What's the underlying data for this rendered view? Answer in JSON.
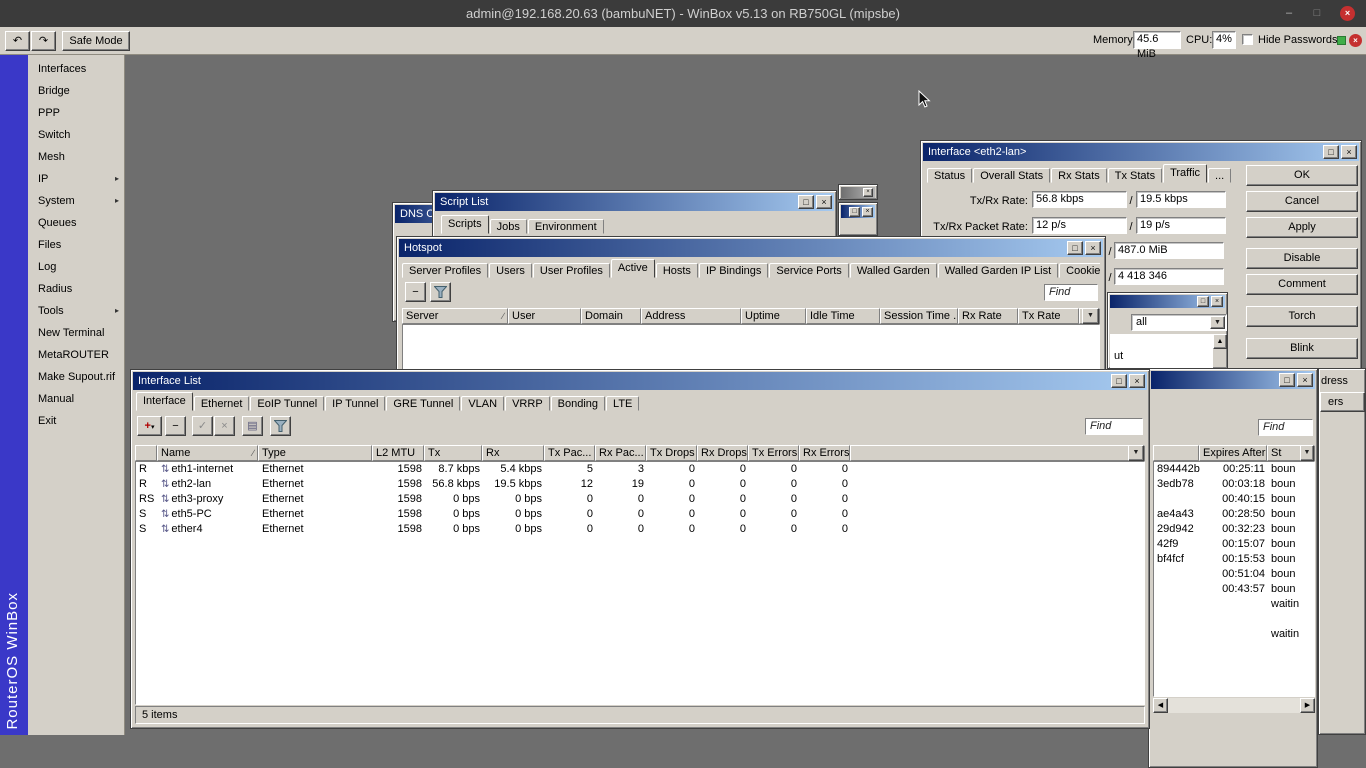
{
  "colors": {
    "titlebar-start": "#0a246a",
    "titlebar-end": "#a6caf0",
    "face": "#d4d0c8",
    "desktop": "#6e6e6e",
    "appbar": "#3b3b3b",
    "brand-blue": "#3a38c8",
    "close-red": "#c53030",
    "ok-green": "#3fae49"
  },
  "icons": {
    "undo": "↶",
    "redo": "↷",
    "minimize": "–",
    "maximize": "□",
    "close": "×",
    "add": "+",
    "remove": "−",
    "enable": "✓",
    "disable": "×",
    "comment": "▤",
    "dropdown": "▼",
    "dropdown_small": "▾",
    "sort": "∕",
    "submenu": "▸",
    "port": "⇅",
    "scroll_up": "▲",
    "scroll_left": "◀",
    "scroll_right": "▶"
  },
  "app": {
    "title": "admin@192.168.20.63 (bambuNET) - WinBox v5.13 on RB750GL (mipsbe)",
    "brand": "RouterOS WinBox"
  },
  "toolbar": {
    "safe_mode": "Safe Mode",
    "memory_label": "Memory:",
    "memory_value": "45.6 MiB",
    "cpu_label": "CPU:",
    "cpu_value": "4%",
    "hide_passwords": "Hide Passwords"
  },
  "menu": {
    "items": [
      {
        "label": "Interfaces"
      },
      {
        "label": "Bridge"
      },
      {
        "label": "PPP"
      },
      {
        "label": "Switch"
      },
      {
        "label": "Mesh"
      },
      {
        "label": "IP",
        "submenu": true
      },
      {
        "label": "System",
        "submenu": true
      },
      {
        "label": "Queues"
      },
      {
        "label": "Files"
      },
      {
        "label": "Log"
      },
      {
        "label": "Radius"
      },
      {
        "label": "Tools",
        "submenu": true
      },
      {
        "label": "New Terminal"
      },
      {
        "label": "MetaROUTER"
      },
      {
        "label": "Make Supout.rif"
      },
      {
        "label": "Manual"
      },
      {
        "label": "Exit"
      }
    ]
  },
  "windows": {
    "dns_cache": {
      "title": "DNS Ca"
    },
    "script_list": {
      "title": "Script List",
      "tabs": [
        "Scripts",
        "Jobs",
        "Environment"
      ],
      "active_tab": "Scripts"
    },
    "interface_detail": {
      "title": "Interface <eth2-lan>",
      "tabs": [
        "Status",
        "Overall Stats",
        "Rx Stats",
        "Tx Stats",
        "Traffic",
        "..."
      ],
      "active_tab": "Traffic",
      "rows": [
        {
          "label": "Tx/Rx Rate:",
          "tx": "56.8 kbps",
          "sep": "/",
          "rx": "19.5 kbps"
        },
        {
          "label": "Tx/Rx Packet Rate:",
          "tx": "12 p/s",
          "sep": "/",
          "rx": "19 p/s"
        }
      ],
      "partial_rows": [
        {
          "sep": "/",
          "value": "487.0 MiB"
        },
        {
          "sep": "/",
          "value": "4 418 346"
        }
      ],
      "buttons": [
        "OK",
        "Cancel",
        "Apply",
        "Disable",
        "Comment",
        "Torch",
        "Blink"
      ]
    },
    "hotspot": {
      "title": "Hotspot",
      "tabs": [
        "Server Profiles",
        "Users",
        "User Profiles",
        "Active",
        "Hosts",
        "IP Bindings",
        "Service Ports",
        "Walled Garden",
        "Walled Garden IP List",
        "Cookies",
        "..."
      ],
      "active_tab": "Active",
      "find": "Find",
      "sorted_column": "Server",
      "columns": [
        "Server",
        "User",
        "Domain",
        "Address",
        "Uptime",
        "Idle Time",
        "Session Time ...",
        "Rx Rate",
        "Tx Rate"
      ]
    },
    "log_fragment": {
      "filter_value": "all",
      "partial_text": "ut"
    },
    "interface_list": {
      "title": "Interface List",
      "tabs": [
        "Interface",
        "Ethernet",
        "EoIP Tunnel",
        "IP Tunnel",
        "GRE Tunnel",
        "VLAN",
        "VRRP",
        "Bonding",
        "LTE"
      ],
      "active_tab": "Interface",
      "find": "Find",
      "sorted_column": "Name",
      "columns": [
        "",
        "Name",
        "Type",
        "L2 MTU",
        "Tx",
        "Rx",
        "Tx Pac...",
        "Rx Pac...",
        "Tx Drops",
        "Rx Drops",
        "Tx Errors",
        "Rx Errors"
      ],
      "rows": [
        {
          "flags": "R",
          "name": "eth1-internet",
          "type": "Ethernet",
          "l2mtu": "1598",
          "tx": "8.7 kbps",
          "rx": "5.4 kbps",
          "tx_packets": "5",
          "rx_packets": "3",
          "tx_drops": "0",
          "rx_drops": "0",
          "tx_errors": "0",
          "rx_errors": "0"
        },
        {
          "flags": "R",
          "name": "eth2-lan",
          "type": "Ethernet",
          "l2mtu": "1598",
          "tx": "56.8 kbps",
          "rx": "19.5 kbps",
          "tx_packets": "12",
          "rx_packets": "19",
          "tx_drops": "0",
          "rx_drops": "0",
          "tx_errors": "0",
          "rx_errors": "0"
        },
        {
          "flags": "RS",
          "name": "eth3-proxy",
          "type": "Ethernet",
          "l2mtu": "1598",
          "tx": "0 bps",
          "rx": "0 bps",
          "tx_packets": "0",
          "rx_packets": "0",
          "tx_drops": "0",
          "rx_drops": "0",
          "tx_errors": "0",
          "rx_errors": "0"
        },
        {
          "flags": "S",
          "name": "eth5-PC",
          "type": "Ethernet",
          "l2mtu": "1598",
          "tx": "0 bps",
          "rx": "0 bps",
          "tx_packets": "0",
          "rx_packets": "0",
          "tx_drops": "0",
          "rx_drops": "0",
          "tx_errors": "0",
          "rx_errors": "0"
        },
        {
          "flags": "S",
          "name": "ether4",
          "type": "Ethernet",
          "l2mtu": "1598",
          "tx": "0 bps",
          "rx": "0 bps",
          "tx_packets": "0",
          "rx_packets": "0",
          "tx_drops": "0",
          "rx_drops": "0",
          "tx_errors": "0",
          "rx_errors": "0"
        }
      ],
      "status_text": "5 items"
    },
    "leases": {
      "find": "Find",
      "columns": [
        "",
        "Expires After",
        "St"
      ],
      "rows": [
        {
          "id": "894442b",
          "expires": "00:25:11",
          "status": "boun"
        },
        {
          "id": "3edb78",
          "expires": "00:03:18",
          "status": "boun"
        },
        {
          "id": "",
          "expires": "00:40:15",
          "status": "boun"
        },
        {
          "id": "ae4a43",
          "expires": "00:28:50",
          "status": "boun"
        },
        {
          "id": "29d942",
          "expires": "00:32:23",
          "status": "boun"
        },
        {
          "id": "42f9",
          "expires": "00:15:07",
          "status": "boun"
        },
        {
          "id": "bf4fcf",
          "expires": "00:15:53",
          "status": "boun"
        },
        {
          "id": "",
          "expires": "00:51:04",
          "status": "boun"
        },
        {
          "id": "",
          "expires": "00:43:57",
          "status": "boun"
        },
        {
          "id": "",
          "expires": "",
          "status": "waitin"
        },
        {
          "id": "",
          "expires": "",
          "status": ""
        },
        {
          "id": "",
          "expires": "",
          "status": "waitin"
        }
      ]
    },
    "background_fragments": {
      "address_partial": "dress",
      "button_partial": "ers"
    }
  }
}
